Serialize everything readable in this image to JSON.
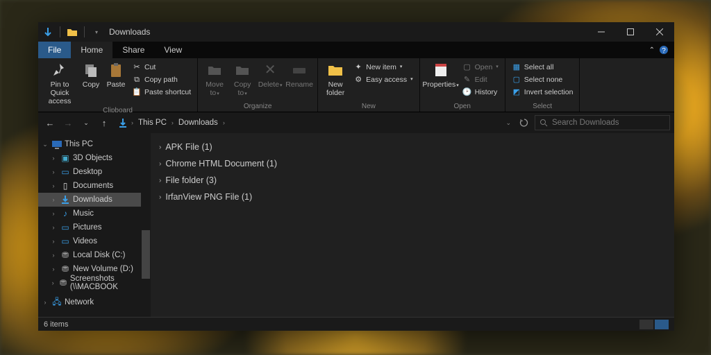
{
  "titlebar": {
    "title": "Downloads"
  },
  "menu": {
    "file": "File",
    "home": "Home",
    "share": "Share",
    "view": "View"
  },
  "ribbon": {
    "clipboard": {
      "label": "Clipboard",
      "pin": "Pin to Quick access",
      "copy": "Copy",
      "paste": "Paste",
      "cut": "Cut",
      "copypath": "Copy path",
      "pasteshortcut": "Paste shortcut"
    },
    "organize": {
      "label": "Organize",
      "moveto": "Move to",
      "copyto": "Copy to",
      "delete": "Delete",
      "rename": "Rename"
    },
    "new": {
      "label": "New",
      "newfolder": "New folder",
      "newitem": "New item",
      "easyaccess": "Easy access"
    },
    "open": {
      "label": "Open",
      "properties": "Properties",
      "open": "Open",
      "edit": "Edit",
      "history": "History"
    },
    "select": {
      "label": "Select",
      "selectall": "Select all",
      "selectnone": "Select none",
      "invert": "Invert selection"
    }
  },
  "path": {
    "seg1": "This PC",
    "seg2": "Downloads"
  },
  "search": {
    "placeholder": "Search Downloads"
  },
  "sidebar": {
    "thispc": "This PC",
    "items": [
      "3D Objects",
      "Desktop",
      "Documents",
      "Downloads",
      "Music",
      "Pictures",
      "Videos",
      "Local Disk (C:)",
      "New Volume (D:)",
      "Screenshots (\\\\MACBOOK"
    ],
    "network": "Network"
  },
  "groups": [
    "APK File (1)",
    "Chrome HTML Document (1)",
    "File folder (3)",
    "IrfanView PNG File (1)"
  ],
  "status": {
    "items": "6 items"
  }
}
